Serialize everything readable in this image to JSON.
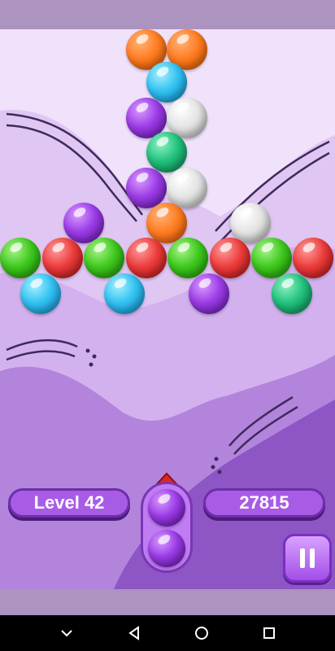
{
  "hud": {
    "level_label": "Level 42",
    "score": "27815"
  },
  "bubble_grid": [
    {
      "color": "orange"
    },
    {
      "color": "orange"
    },
    {
      "color": "blue"
    },
    {
      "color": "purple"
    },
    {
      "color": "white"
    },
    {
      "color": "teal"
    },
    {
      "color": "purple"
    },
    {
      "color": "white"
    },
    {
      "color": "purple"
    },
    {
      "color": "orange"
    },
    {
      "color": "white"
    },
    {
      "color": "green"
    },
    {
      "color": "red"
    },
    {
      "color": "green"
    },
    {
      "color": "red"
    },
    {
      "color": "green"
    },
    {
      "color": "red"
    },
    {
      "color": "green"
    },
    {
      "color": "red"
    },
    {
      "color": "blue"
    },
    {
      "color": "blue"
    },
    {
      "color": "purple"
    },
    {
      "color": "teal"
    }
  ],
  "shooter": {
    "current_bubble": "purple",
    "next_bubble": "purple"
  },
  "icons": {
    "aim": "aim-arrow-icon",
    "pause": "pause-icon",
    "nav_back": "back-triangle-icon",
    "nav_home": "home-circle-icon",
    "nav_recents": "recents-square-icon",
    "nav_down": "chevron-down-icon"
  },
  "colors": {
    "accent": "#a85ce6",
    "background": "#f1e2fb",
    "bar": "#ad93bf"
  }
}
